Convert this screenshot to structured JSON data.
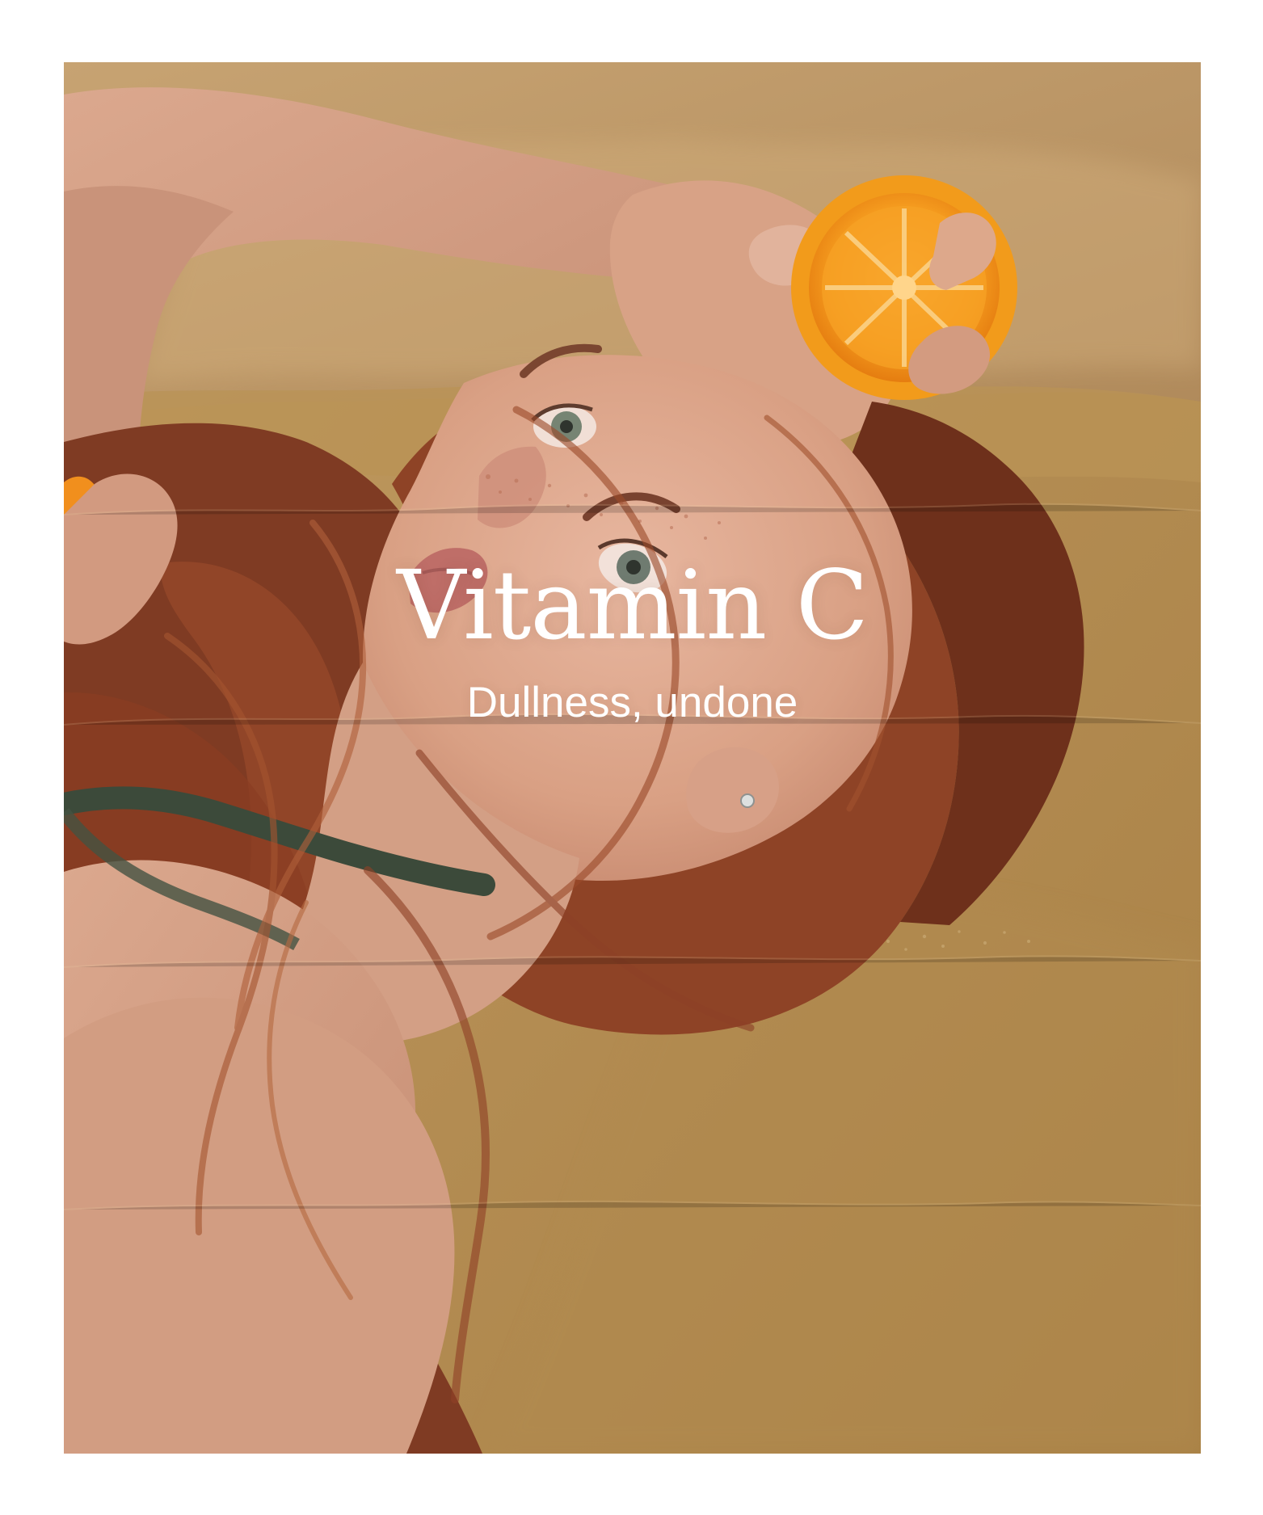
{
  "hero": {
    "title": "Vitamin C",
    "subtitle": "Dullness, undone"
  },
  "photo": {
    "palette": {
      "sand": "#c7a16d",
      "blanket": "#b58f55",
      "skin": "#d7a287",
      "hair": "#7b3a23",
      "orange": "#f39a1b",
      "strap": "#3d4a3b"
    }
  }
}
